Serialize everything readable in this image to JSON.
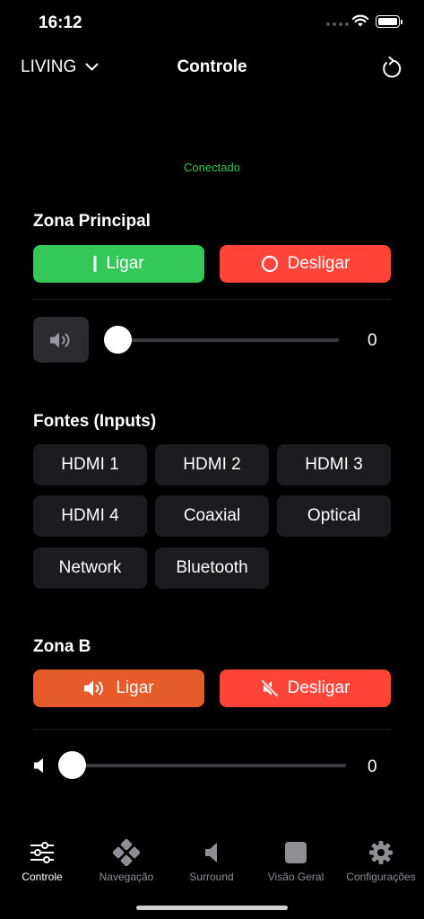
{
  "status_bar": {
    "time": "16:12"
  },
  "nav": {
    "zone_selector": "LIVING",
    "title": "Controle"
  },
  "connection_status": "Conectado",
  "zona_principal": {
    "title": "Zona Principal",
    "on_label": "Ligar",
    "off_label": "Desligar",
    "volume": 0,
    "volume_label": "0"
  },
  "inputs": {
    "title": "Fontes (Inputs)",
    "items": [
      "HDMI 1",
      "HDMI 2",
      "HDMI 3",
      "HDMI 4",
      "Coaxial",
      "Optical",
      "Network",
      "Bluetooth"
    ]
  },
  "zona_b": {
    "title": "Zona B",
    "on_label": "Ligar",
    "off_label": "Desligar",
    "volume": 0,
    "volume_label": "0"
  },
  "tabs": [
    {
      "label": "Controle",
      "icon": "sliders-icon",
      "active": true
    },
    {
      "label": "Navegação",
      "icon": "gamepad-icon",
      "active": false
    },
    {
      "label": "Surround",
      "icon": "speaker-icon",
      "active": false
    },
    {
      "label": "Visão Geral",
      "icon": "square-icon",
      "active": false
    },
    {
      "label": "Configurações",
      "icon": "gear-icon",
      "active": false
    }
  ],
  "colors": {
    "green": "#34c759",
    "red": "#ff453a",
    "orange": "#e65b2a",
    "status_green": "#35c759"
  }
}
